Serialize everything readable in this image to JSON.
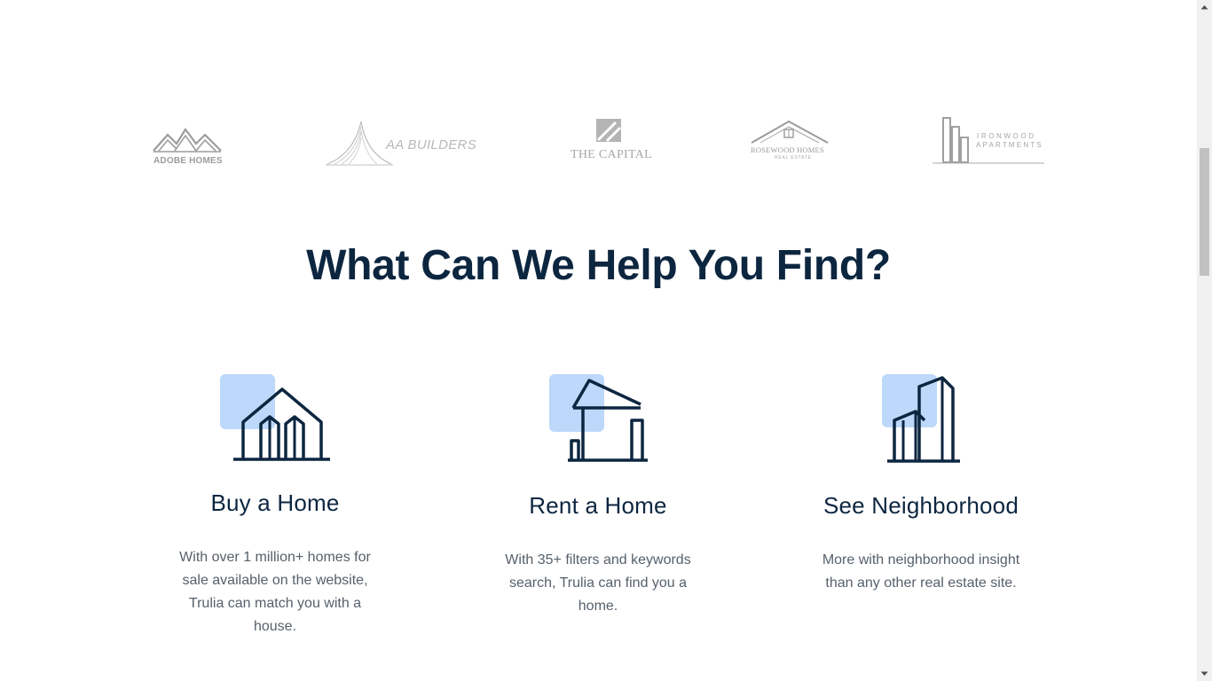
{
  "logos": {
    "adobe": "ADOBE HOMES",
    "aa_builders": "AA BUILDERS",
    "capital": "THE CAPITAL",
    "rosewood": "ROSEWOOD HOMES",
    "rosewood_sub": "REAL ESTATE",
    "ironwood_line1": "IRONWOOD",
    "ironwood_line2": "APARTMENTS"
  },
  "heading": "What Can We Help You Find?",
  "cards": [
    {
      "icon": "house-icon",
      "title": "Buy a Home",
      "description": "With over 1 million+ homes for sale available on the website, Trulia can match you with a house."
    },
    {
      "icon": "rent-house-icon",
      "title": "Rent a Home",
      "description": "With 35+ filters and keywords search, Trulia can find you a home."
    },
    {
      "icon": "buildings-icon",
      "title": "See Neighborhood",
      "description": "More with neighborhood insight than any other real estate site."
    }
  ],
  "colors": {
    "heading": "#0d2640",
    "accent_square": "#bcd8fa",
    "icon_stroke": "#0d2640",
    "body_text": "#57606b"
  }
}
